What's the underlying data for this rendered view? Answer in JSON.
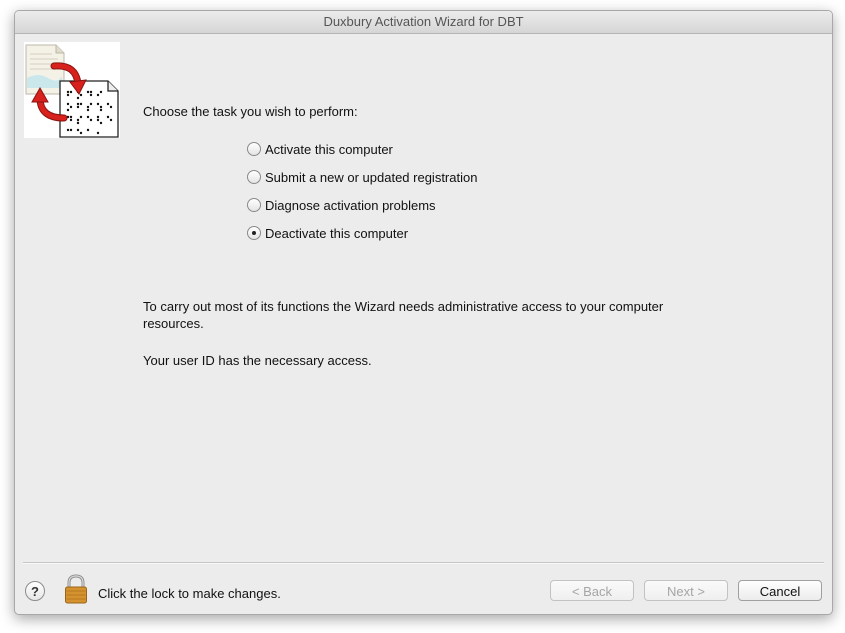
{
  "window": {
    "title": "Duxbury Activation Wizard for DBT"
  },
  "main": {
    "prompt": "Choose the task you wish to perform:",
    "options": [
      {
        "label": "Activate this computer",
        "selected": false
      },
      {
        "label": "Submit a new or updated registration",
        "selected": false
      },
      {
        "label": "Diagnose activation problems",
        "selected": false
      },
      {
        "label": "Deactivate this computer",
        "selected": true
      }
    ],
    "info_admin": "To carry out most of its functions the Wizard needs administrative access to your computer resources.",
    "info_user": "Your user ID has the necessary access."
  },
  "footer": {
    "help_label": "?",
    "lock_text": "Click the lock to make changes.",
    "back_label": "< Back",
    "next_label": "Next >",
    "cancel_label": "Cancel"
  },
  "icons": {
    "wizard": "document-exchange-icon",
    "lock": "lock-icon",
    "help": "help-icon"
  },
  "colors": {
    "window_bg": "#ececec",
    "arrow_red": "#d8201c",
    "lock_gold": "#d4932f"
  }
}
